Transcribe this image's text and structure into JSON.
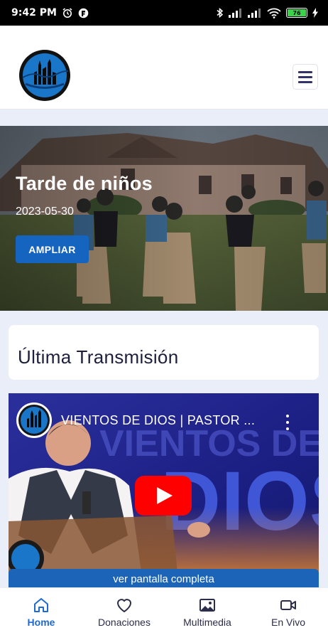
{
  "status_bar": {
    "time": "9:42 PM",
    "battery_level": "76",
    "icons": [
      "alarm-icon",
      "app-notification-icon",
      "bluetooth-icon",
      "signal-icon",
      "signal-icon",
      "wifi-icon",
      "battery-icon",
      "charging-icon"
    ]
  },
  "header": {
    "logo_icon": "church-logo",
    "menu_icon": "hamburger-menu-icon"
  },
  "hero": {
    "title": "Tarde de niños",
    "date": "2023-05-30",
    "button_label": "AMPLIAR"
  },
  "section": {
    "title": "Última Transmisión"
  },
  "video": {
    "title": "VIENTOS DE DIOS | PASTOR ...",
    "overlay_text_top": "VIENTOS DE",
    "overlay_text_big": "DIOS",
    "fullscreen_label": "ver pantalla completa",
    "colors": {
      "play": "#ff0000",
      "bar": "#1b64b8"
    }
  },
  "bottom_nav": {
    "items": [
      {
        "label": "Home",
        "icon": "home-icon",
        "active": true
      },
      {
        "label": "Donaciones",
        "icon": "heart-icon",
        "active": false
      },
      {
        "label": "Multimedia",
        "icon": "image-icon",
        "active": false
      },
      {
        "label": "En Vivo",
        "icon": "video-camera-icon",
        "active": false
      }
    ]
  },
  "colors": {
    "accent": "#1e6ad0",
    "button": "#1565c0",
    "page_bg": "#e9eef8"
  }
}
